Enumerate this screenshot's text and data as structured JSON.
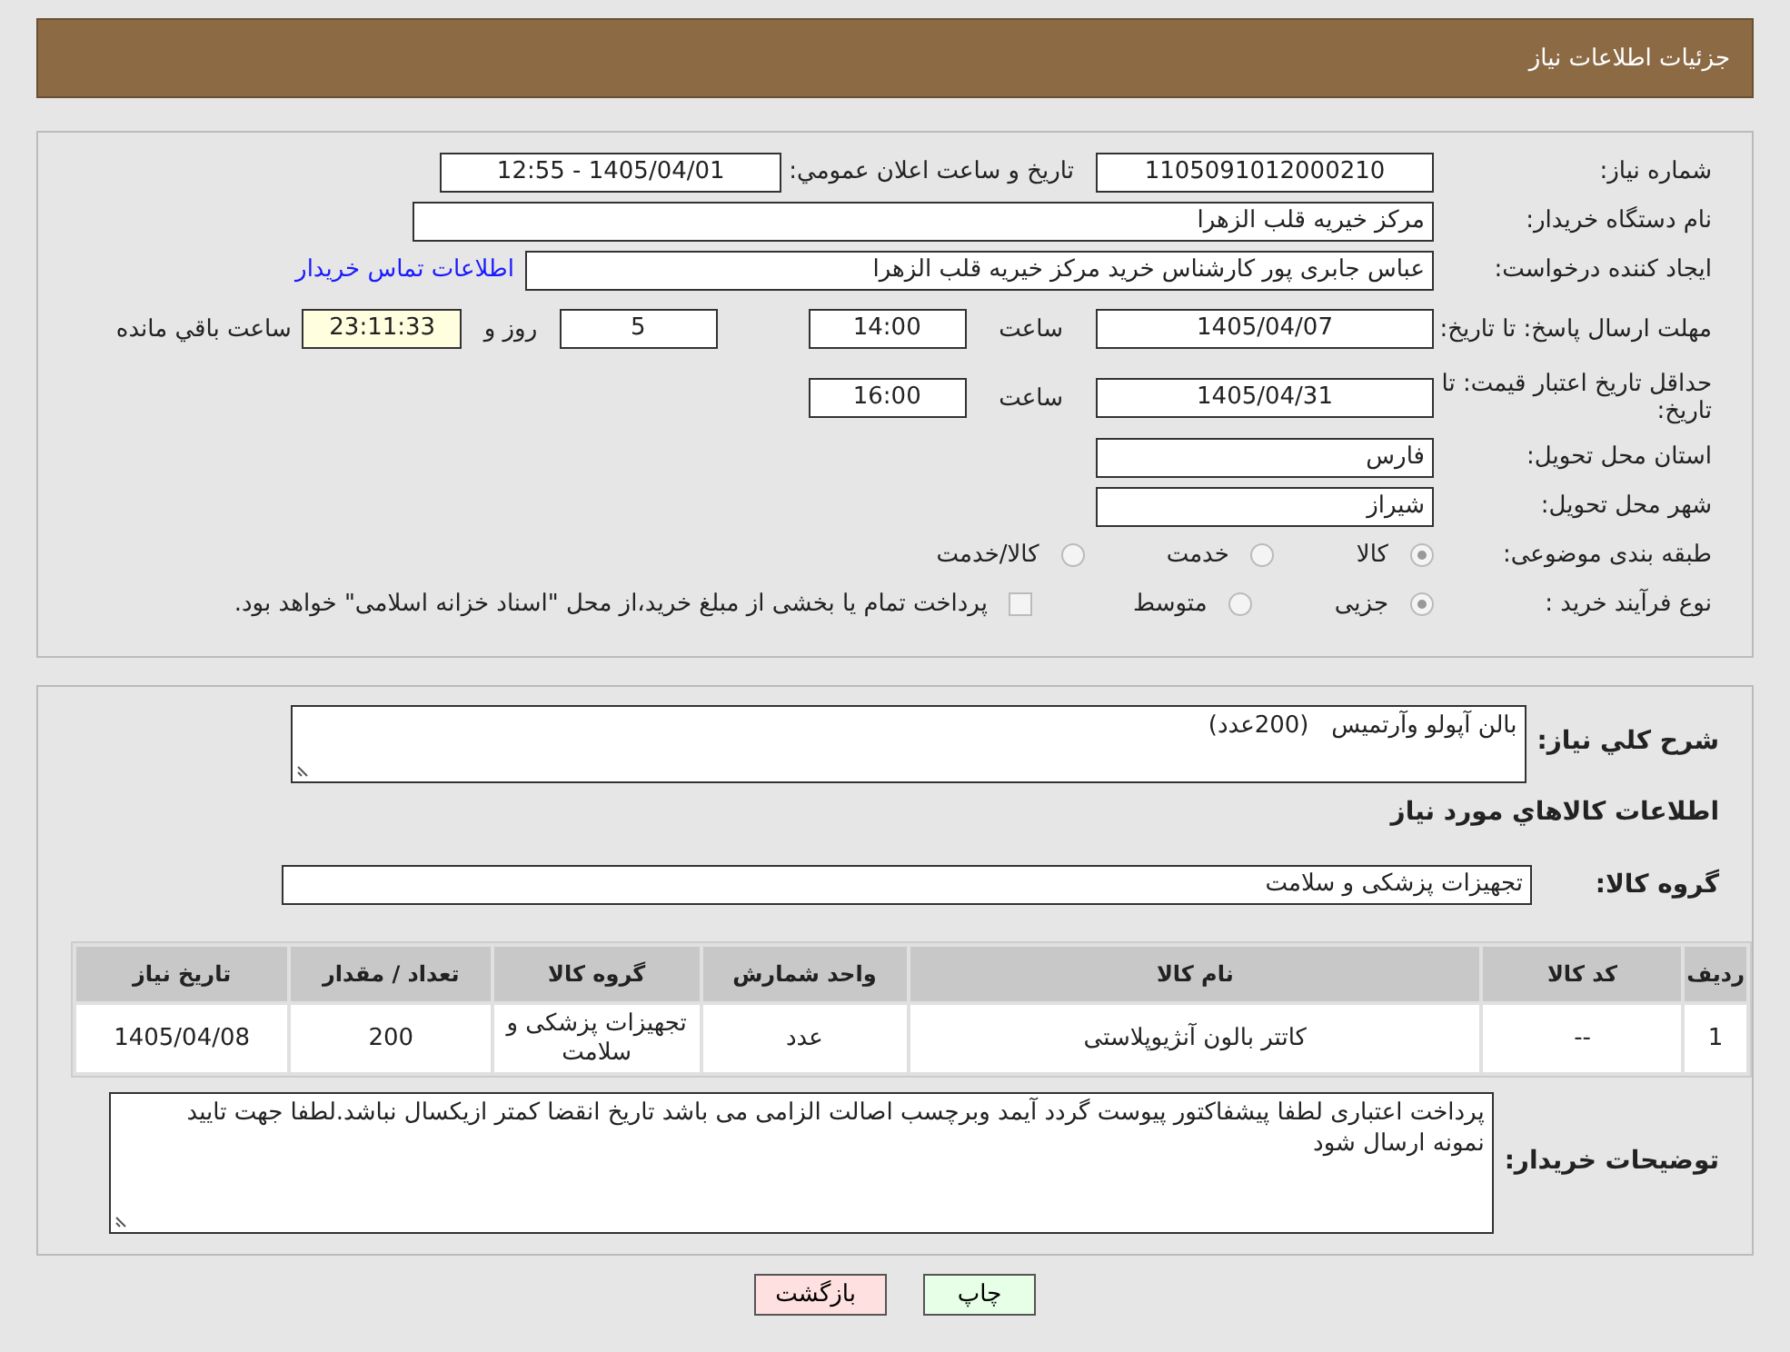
{
  "header": {
    "title": "جزئیات اطلاعات نیاز"
  },
  "details": {
    "need_number": {
      "label": "شماره نیاز:",
      "value": "1105091012000210"
    },
    "announce_datetime": {
      "label": "تاریخ و ساعت اعلان عمومي:",
      "value": "1405/04/01 - 12:55"
    },
    "buyer_org": {
      "label": "نام دستگاه خریدار:",
      "value": "مرکز خیریه قلب الزهرا"
    },
    "requester": {
      "label": "ایجاد کننده درخواست:",
      "value": "عباس جابری پور کارشناس خرید مرکز خیریه قلب الزهرا",
      "contact_link": "اطلاعات تماس خریدار"
    },
    "response_deadline": {
      "label": "مهلت ارسال پاسخ: تا تاریخ:",
      "date": "1405/04/07",
      "time_label": "ساعت",
      "time": "14:00",
      "days": "5",
      "days_label": "روز و",
      "remaining": "23:11:33",
      "remaining_label": "ساعت باقي مانده"
    },
    "price_validity": {
      "label": "حداقل تاریخ اعتبار قیمت: تا تاریخ:",
      "date": "1405/04/31",
      "time_label": "ساعت",
      "time": "16:00"
    },
    "province": {
      "label": "استان محل تحویل:",
      "value": "فارس"
    },
    "city": {
      "label": "شهر محل تحویل:",
      "value": "شیراز"
    },
    "category": {
      "label": "طبقه بندی موضوعی:",
      "options": [
        {
          "label": "کالا",
          "selected": true
        },
        {
          "label": "خدمت",
          "selected": false
        },
        {
          "label": "کالا/خدمت",
          "selected": false
        }
      ]
    },
    "process": {
      "label": "نوع فرآیند خرید :",
      "options": [
        {
          "label": "جزیی",
          "selected": true
        },
        {
          "label": "متوسط",
          "selected": false
        }
      ],
      "treasury": {
        "label": "پرداخت تمام یا بخشی از مبلغ خرید،از محل \"اسناد خزانه اسلامی\" خواهد بود.",
        "checked": false
      }
    }
  },
  "need": {
    "summary": {
      "label": "شرح کلي نیاز:",
      "value": "بالن آپولو وآرتمیس   (200عدد)"
    },
    "goods_heading": "اطلاعات کالاهاي مورد نیاز",
    "goods_group": {
      "label": "گروه کالا:",
      "value": "تجهیزات پزشکی و سلامت"
    },
    "table": {
      "columns": [
        "ردیف",
        "کد کالا",
        "نام کالا",
        "واحد شمارش",
        "گروه کالا",
        "تعداد / مقدار",
        "تاریخ نیاز"
      ],
      "rows": [
        [
          "1",
          "--",
          "کاتتر بالون آنژیوپلاستی",
          "عدد",
          "تجهیزات پزشکی و سلامت",
          "200",
          "1405/04/08"
        ]
      ]
    },
    "buyer_notes": {
      "label": "توضیحات خریدار:",
      "value": "پرداخت اعتباری لطفا پیشفاکتور پیوست گردد آیمد وبرچسب اصالت الزامی می باشد تاریخ انقضا کمتر ازیکسال نباشد.لطفا جهت تایید نمونه ارسال شود"
    }
  },
  "buttons": [
    {
      "label": "چاپ",
      "kind": "print"
    },
    {
      "label": "بازگشت",
      "kind": "back"
    }
  ]
}
